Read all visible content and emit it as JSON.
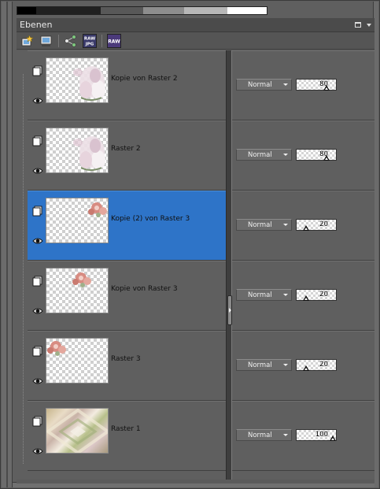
{
  "palette_title": "Ebenen",
  "color_strip": [
    "#000000",
    "#202020",
    "#585858",
    "#8d8d8d",
    "#b7b7b7",
    "#ffffff"
  ],
  "toolbar": {
    "buttons": [
      {
        "name": "new-raster-layer",
        "icon": "layer-new-icon"
      },
      {
        "name": "layer-properties",
        "icon": "layer-properties-icon"
      },
      {
        "name": "link-layers",
        "icon": "link-icon"
      },
      {
        "name": "raw-jpg",
        "icon": "raw-jpg-icon",
        "line1": "RAW",
        "line2": "JPG"
      },
      {
        "name": "raw",
        "icon": "raw-icon",
        "label": "RAW"
      }
    ]
  },
  "layers": [
    {
      "name": "Kopie von Raster 2",
      "blend": "Normal",
      "opacity": 80,
      "selected": false,
      "thumb": "lilies"
    },
    {
      "name": "Raster 2",
      "blend": "Normal",
      "opacity": 80,
      "selected": false,
      "thumb": "lilies"
    },
    {
      "name": "Kopie (2) von Raster 3",
      "blend": "Normal",
      "opacity": 20,
      "selected": true,
      "thumb": "roses-right"
    },
    {
      "name": "Kopie von Raster 3",
      "blend": "Normal",
      "opacity": 20,
      "selected": false,
      "thumb": "roses-mid"
    },
    {
      "name": "Raster 3",
      "blend": "Normal",
      "opacity": 20,
      "selected": false,
      "thumb": "roses-left"
    },
    {
      "name": "Raster 1",
      "blend": "Normal",
      "opacity": 100,
      "selected": false,
      "thumb": "background"
    }
  ],
  "colors": {
    "selection": "#2e74c8",
    "panel": "#5f5f5f"
  }
}
